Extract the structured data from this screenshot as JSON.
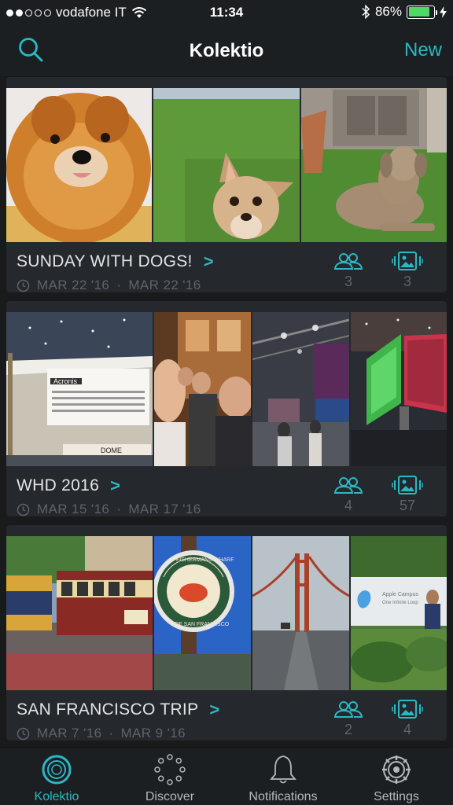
{
  "status_bar": {
    "carrier": "vodafone IT",
    "time": "11:34",
    "battery": "86%",
    "battery_level": 0.86
  },
  "nav": {
    "title": "Kolektio",
    "new_label": "New"
  },
  "collections": [
    {
      "title": "SUNDAY WITH DOGS!",
      "start_date": "MAR 22 '16",
      "end_date": "MAR 22 '16",
      "members": "3",
      "photos": "3"
    },
    {
      "title": "WHD 2016",
      "start_date": "MAR 15 '16",
      "end_date": "MAR 17 '16",
      "members": "4",
      "photos": "57"
    },
    {
      "title": "SAN FRANCISCO TRIP",
      "start_date": "MAR 7 '16",
      "end_date": "MAR 9 '16",
      "members": "2",
      "photos": "4"
    }
  ],
  "photo_text": {
    "acronis": "Acronis",
    "dome": "DOME",
    "wharf_top": "FISHERMANS WHARF",
    "wharf_bottom": "OF SAN FRANCISCO",
    "campus_1": "Apple Campus",
    "campus_2": "One Infinite Loop"
  },
  "tabs": [
    {
      "label": "Kolektio",
      "active": true
    },
    {
      "label": "Discover",
      "active": false
    },
    {
      "label": "Notifications",
      "active": false
    },
    {
      "label": "Settings",
      "active": false
    }
  ],
  "colors": {
    "accent": "#2bb8c4",
    "background": "#1b1e21",
    "card": "#25282c",
    "muted_text": "#5e646a"
  }
}
